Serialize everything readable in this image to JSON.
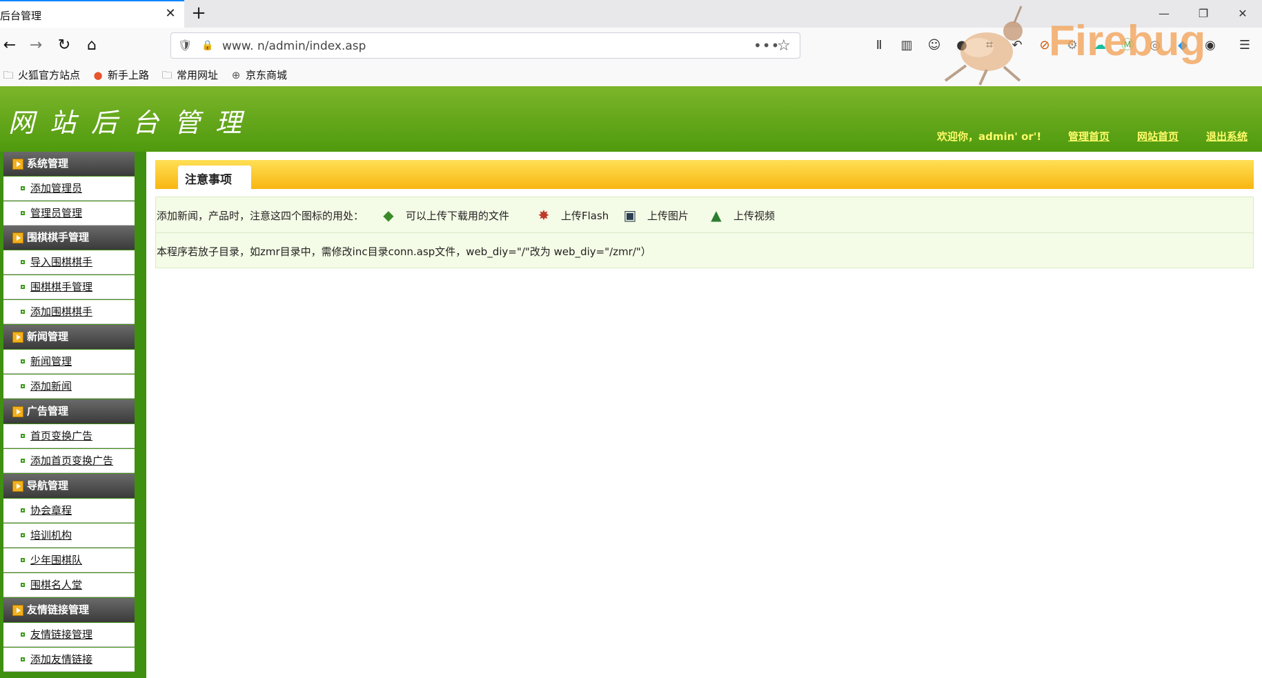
{
  "browser": {
    "tab_title": "后台管理",
    "close_label": "✕",
    "newtab_label": "+",
    "window_buttons": {
      "minimize": "—",
      "restore": "❐",
      "close": "✕"
    },
    "nav": {
      "back": "←",
      "forward": "→",
      "reload": "↻",
      "home": "⌂"
    },
    "url": "www.        n/admin/index.asp",
    "url_more": "•••",
    "url_star": "☆",
    "toolbar_icons": [
      "library-icon",
      "sidebar-icon",
      "account-icon",
      "chat-icon",
      "crop-icon",
      "undo-icon",
      "block-icon",
      "gear-icon",
      "cloud-icon",
      "m-extension-icon",
      "globe-icon",
      "cube-icon",
      "circle-icon",
      "menu-icon"
    ],
    "firebug_watermark": "Firebug",
    "bookmarks": [
      {
        "label": "火狐官方站点",
        "icon": "folder-icon"
      },
      {
        "label": "新手上路",
        "icon": "firefox-icon"
      },
      {
        "label": "常用网址",
        "icon": "folder-icon"
      },
      {
        "label": "京东商城",
        "icon": "globe-icon"
      }
    ]
  },
  "header": {
    "logo": "网站后台管理",
    "welcome": "欢迎你，admin' or'!",
    "links": [
      "管理首页",
      "网站首页",
      "退出系统"
    ],
    "colors": {
      "header_top": "#7cb52a",
      "header_bottom": "#4f9a0e",
      "link": "#fffb6a"
    }
  },
  "sidebar": {
    "sections": [
      {
        "label": "系统管理",
        "items": [
          "添加管理员",
          "管理员管理"
        ]
      },
      {
        "label": "围棋棋手管理",
        "items": [
          "导入围棋棋手",
          "围棋棋手管理",
          "添加围棋棋手"
        ]
      },
      {
        "label": "新闻管理",
        "items": [
          "新闻管理",
          "添加新闻"
        ]
      },
      {
        "label": "广告管理",
        "items": [
          "首页变换广告",
          "添加首页变换广告"
        ]
      },
      {
        "label": "导航管理",
        "items": [
          "协会章程",
          "培训机构",
          "少年围棋队",
          "围棋名人堂"
        ]
      },
      {
        "label": "友情链接管理",
        "items": [
          "友情链接管理",
          "添加友情链接"
        ]
      }
    ]
  },
  "notice": {
    "title": "注意事项",
    "row1_prefix": "添加新闻，产品时，注意这四个图标的用处：",
    "icons": [
      {
        "label": "可以上传下载用的文件",
        "icon": "upload-file-icon"
      },
      {
        "label": "上传Flash",
        "icon": "flash-icon"
      },
      {
        "label": "上传图片",
        "icon": "image-icon"
      },
      {
        "label": "上传视频",
        "icon": "video-icon"
      }
    ],
    "row2": "本程序若放子目录，如zmr目录中，需修改inc目录conn.asp文件，web_diy=\"/\"改为 web_diy=\"/zmr/\"）"
  }
}
